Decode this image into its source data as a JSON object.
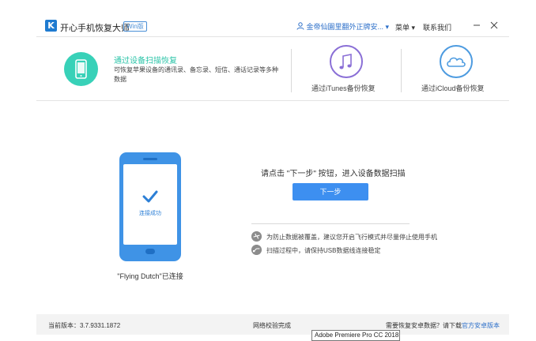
{
  "titlebar": {
    "app_title": "开心手机恢复大师",
    "win_badge": "Win版",
    "user_name": "金帝仙園里翻外正牌安...",
    "menu_label": "菜单",
    "contact_label": "联系我们",
    "icons": [
      "app-logo-icon",
      "user-icon",
      "dropdown-icon",
      "minimize-icon",
      "close-icon"
    ]
  },
  "modes": {
    "device_scan": {
      "title": "通过设备扫描恢复",
      "description": "可恢复苹果设备的通讯录、备忘录、短信、通话记录等多种数据",
      "icon": "phone-icon"
    },
    "itunes": {
      "label": "通过iTunes备份恢复",
      "icon": "music-note-icon"
    },
    "icloud": {
      "label": "通过iCloud备份恢复",
      "icon": "cloud-icon"
    }
  },
  "device": {
    "status_text": "连接成功",
    "device_name": "\"Flying Dutch\"已连接"
  },
  "main": {
    "instruction": "请点击 \"下一步\" 按钮，进入设备数据扫描",
    "next_button": "下一步",
    "tips": [
      {
        "text": "为防止数据被覆盖，建议您开启飞行模式并尽量停止使用手机",
        "icon": "airplane-icon"
      },
      {
        "text": "扫描过程中，请保持USB数据线连接稳定",
        "icon": "usb-cable-icon"
      }
    ]
  },
  "footer": {
    "version": "当前版本：3.7.9331.1872",
    "net_status": "网络校验完成",
    "android_prompt": "需要恢复安卓数据？请下载",
    "android_link": "官方安卓版本",
    "tooltip": "Adobe Premiere Pro CC 2018 \\"
  },
  "colors": {
    "accent": "#3d8ff0",
    "teal": "#38d1b8",
    "purple": "#8a6fd6",
    "link": "#2c6fc9"
  }
}
